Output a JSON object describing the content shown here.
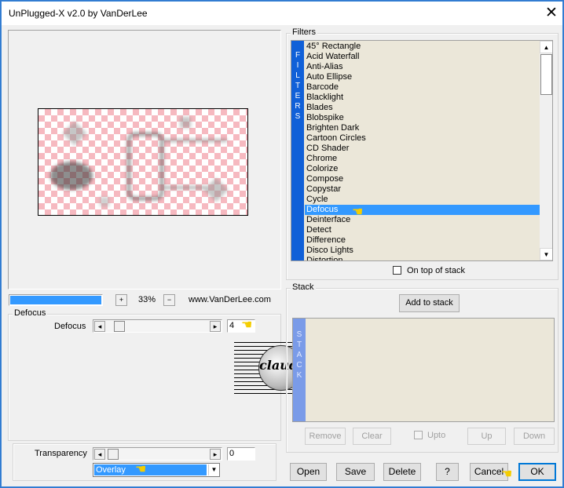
{
  "window": {
    "title": "UnPlugged-X v2.0 by VanDerLee",
    "close_glyph": "✕"
  },
  "zoom": {
    "plus": "+",
    "minus": "−",
    "value": "33%",
    "site": "www.VanDerLee.com"
  },
  "filters": {
    "group_label": "Filters",
    "side_letters": [
      "F",
      "I",
      "L",
      "T",
      "E",
      "R",
      "S"
    ],
    "items": [
      "45° Rectangle",
      "Acid Waterfall",
      "Anti-Alias",
      "Auto Ellipse",
      "Barcode",
      "Blacklight",
      "Blades",
      "Blobspike",
      "Brighten Dark",
      "Cartoon Circles",
      "CD Shader",
      "Chrome",
      "Colorize",
      "Compose",
      "Copystar",
      "Cycle",
      "Defocus",
      "Deinterface",
      "Detect",
      "Difference",
      "Disco Lights",
      "Distortion"
    ],
    "selected_index": 16,
    "on_top_label": "On top of stack",
    "scroll_up": "▲",
    "scroll_down": "▼"
  },
  "stack": {
    "group_label": "Stack",
    "add_label": "Add to stack",
    "side_letters": [
      "S",
      "T",
      "A",
      "C",
      "K"
    ],
    "remove_label": "Remove",
    "clear_label": "Clear",
    "upto_label": "Upto",
    "up_label": "Up",
    "down_label": "Down"
  },
  "defocus": {
    "group_label": "Defocus",
    "param_label": "Defocus",
    "param_value": "4",
    "arrow_left": "◂",
    "arrow_right": "▸"
  },
  "transparency": {
    "label": "Transparency",
    "value": "0",
    "level": 0
  },
  "blend": {
    "selected": "Overlay",
    "arrow": "▼"
  },
  "buttons": {
    "open": "Open",
    "save": "Save",
    "delete": "Delete",
    "help": "?",
    "cancel": "Cancel",
    "ok": "OK"
  },
  "watermark": {
    "text": "claudia"
  },
  "hand_glyph": "☚",
  "colors": {
    "accent": "#3399ff",
    "filter_bar": "#1060d8",
    "stack_bar": "#7a9be8",
    "list_bg": "#ebe7d9"
  }
}
